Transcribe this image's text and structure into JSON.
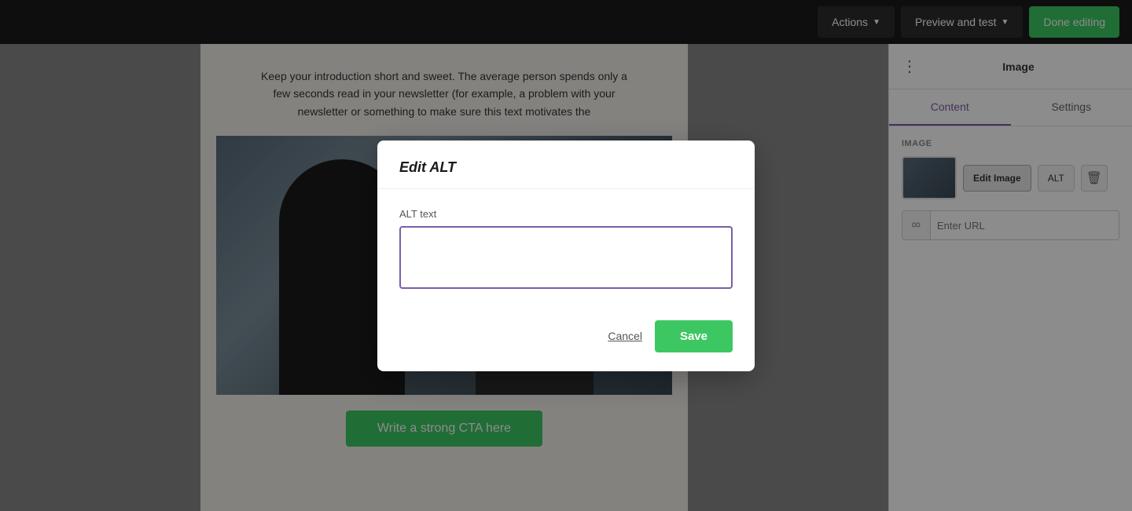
{
  "topbar": {
    "actions_label": "Actions",
    "preview_label": "Preview and test",
    "done_label": "Done editing"
  },
  "sidebar": {
    "title": "Image",
    "tabs": [
      {
        "label": "Content",
        "active": true
      },
      {
        "label": "Settings",
        "active": false
      }
    ],
    "image_section_label": "IMAGE",
    "edit_image_btn": "Edit Image",
    "alt_btn": "ALT",
    "url_placeholder": "Enter URL"
  },
  "email": {
    "intro_text": "Keep your introduction short and sweet. The average person spends only a few seconds read in your newsletter (for example, a problem with your newsletter or something to make sure this text motivates the",
    "cta_label": "Write a strong CTA here"
  },
  "modal": {
    "title": "Edit ",
    "title_emphasis": "ALT",
    "field_label": "ALT text",
    "cancel_label": "Cancel",
    "save_label": "Save"
  }
}
